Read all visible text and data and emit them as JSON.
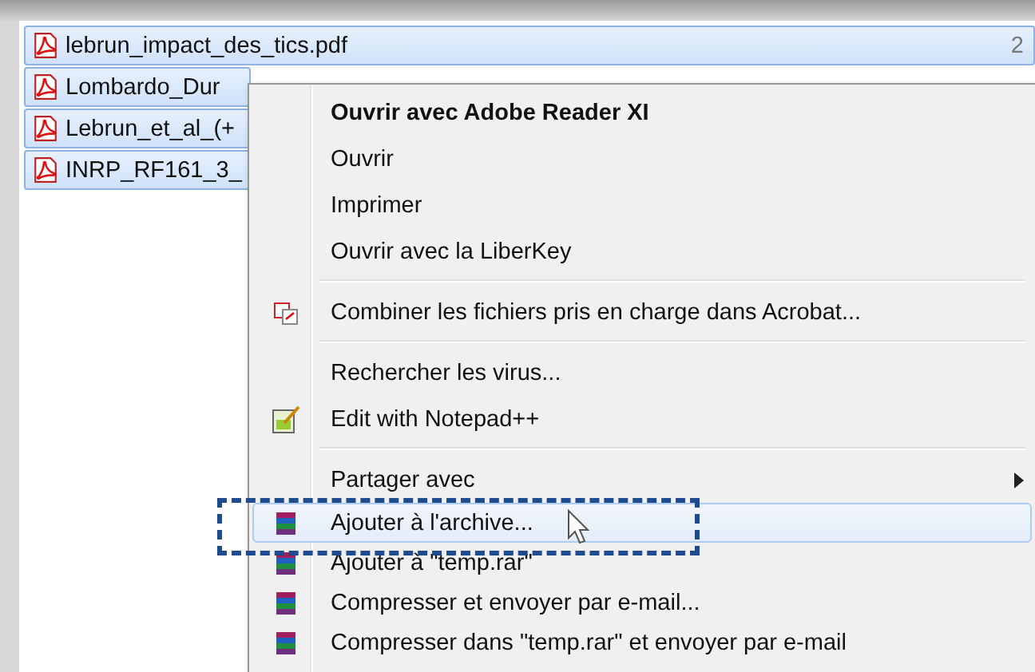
{
  "files": [
    {
      "name": "lebrun_impact_des_tics.pdf",
      "column_2": "2",
      "selected": true
    },
    {
      "name": "Lombardo_Dur",
      "selected": true
    },
    {
      "name": "Lebrun_et_al_(+",
      "selected": true
    },
    {
      "name": "INRP_RF161_3_",
      "selected": true
    }
  ],
  "context_menu": [
    {
      "kind": "item",
      "label": "Ouvrir avec Adobe Reader XI",
      "bold": true,
      "selected": false
    },
    {
      "kind": "item",
      "label": "Ouvrir",
      "selected": false
    },
    {
      "kind": "item",
      "label": "Imprimer",
      "selected": false
    },
    {
      "kind": "item",
      "label": "Ouvrir avec la LiberKey",
      "selected": false
    },
    {
      "kind": "separator"
    },
    {
      "kind": "item",
      "label": "Combiner les fichiers pris en charge dans Acrobat...",
      "selected": false
    },
    {
      "kind": "separator"
    },
    {
      "kind": "item",
      "label": "Rechercher les virus...",
      "selected": false
    },
    {
      "kind": "item",
      "label": "Edit with Notepad++",
      "selected": false
    },
    {
      "kind": "separator"
    },
    {
      "kind": "item",
      "label": "Partager avec",
      "submenu": true,
      "selected": false
    },
    {
      "kind": "item",
      "label": "Ajouter à l'archive...",
      "selected": true,
      "annotated": true
    },
    {
      "kind": "item",
      "label": "Ajouter à \"temp.rar\"",
      "selected": false
    },
    {
      "kind": "item",
      "label": "Compresser et envoyer par e-mail...",
      "selected": false
    },
    {
      "kind": "item",
      "label": "Compresser dans \"temp.rar\" et envoyer par e-mail",
      "selected": false
    }
  ]
}
